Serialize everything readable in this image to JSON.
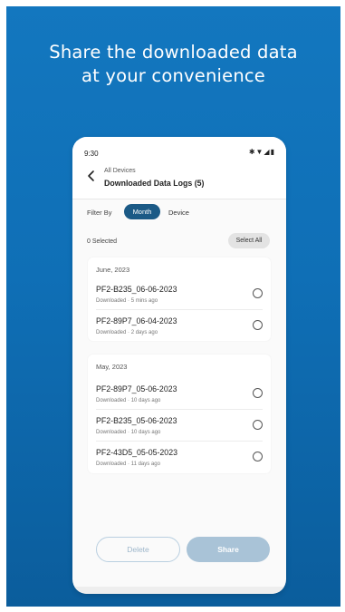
{
  "headline": [
    "Share the downloaded data",
    "at your convenience"
  ],
  "status_bar": {
    "time": "9:30",
    "icons": "✱▼◢▮"
  },
  "app_bar": {
    "breadcrumb": "All Devices",
    "title": "Downloaded Data Logs (5)"
  },
  "filter": {
    "label": "Filter By",
    "options": [
      "Month",
      "Device"
    ],
    "selected": "Month"
  },
  "selection": {
    "count_text": "0 Selected",
    "select_all_label": "Select All"
  },
  "groups": [
    {
      "title": "June, 2023",
      "items": [
        {
          "name": "PF2-B235_06-06-2023",
          "meta": "Downloaded · 5 mins ago"
        },
        {
          "name": "PF2-89P7_06-04-2023",
          "meta": "Downloaded · 2 days ago"
        }
      ]
    },
    {
      "title": "May, 2023",
      "items": [
        {
          "name": "PF2-89P7_05-06-2023",
          "meta": "Downloaded · 10 days ago"
        },
        {
          "name": "PF2-B235_05-06-2023",
          "meta": "Downloaded · 10 days ago"
        },
        {
          "name": "PF2-43D5_05-05-2023",
          "meta": "Downloaded · 11 days ago"
        }
      ]
    }
  ],
  "actions": {
    "delete_label": "Delete",
    "share_label": "Share"
  },
  "colors": {
    "background": "#1377bf",
    "chip_active": "#1b5a86",
    "share_disabled": "#a9c3d7"
  }
}
